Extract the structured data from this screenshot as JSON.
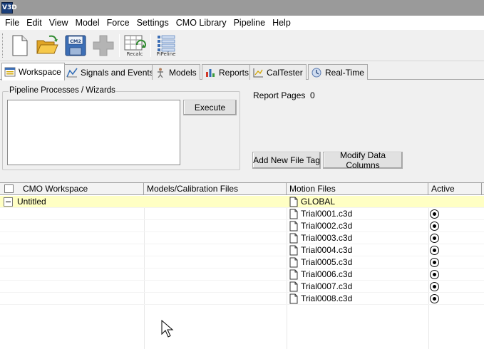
{
  "window": {
    "icon_text": "V3D"
  },
  "menu": [
    "File",
    "Edit",
    "View",
    "Model",
    "Force",
    "Settings",
    "CMO Library",
    "Pipeline",
    "Help"
  ],
  "toolbar": {
    "new_icon": "new-document-icon",
    "open_icon": "open-folder-icon",
    "save_icon": "save-disk-icon",
    "save_badge": "CM2",
    "add_icon": "plus-icon",
    "recalc_label": "Recalc",
    "pipeline_label": "PiPeline"
  },
  "tabs": [
    {
      "label": "Workspace",
      "icon": "workspace-icon",
      "active": true
    },
    {
      "label": "Signals and Events",
      "icon": "signals-icon"
    },
    {
      "label": "Models",
      "icon": "model-figure-icon"
    },
    {
      "label": "Reports",
      "icon": "bar-chart-icon"
    },
    {
      "label": "CalTester",
      "icon": "caltester-icon"
    },
    {
      "label": "Real-Time",
      "icon": "realtime-icon"
    }
  ],
  "pipeline_panel": {
    "title": "Pipeline Processes / Wizards",
    "execute_label": "Execute"
  },
  "report": {
    "label": "Report Pages",
    "count": "0"
  },
  "buttons": {
    "add_file_tag": "Add New File Tag",
    "modify_columns": "Modify Data Columns"
  },
  "grid": {
    "columns": [
      "CMO Workspace",
      "Models/Calibration Files",
      "Motion Files",
      "Active"
    ],
    "workspace_name": "Untitled",
    "global_label": "GLOBAL",
    "files": [
      "Trial0001.c3d",
      "Trial0002.c3d",
      "Trial0003.c3d",
      "Trial0004.c3d",
      "Trial0005.c3d",
      "Trial0006.c3d",
      "Trial0007.c3d",
      "Trial0008.c3d"
    ]
  },
  "colors": {
    "global_row": "#ffffc4",
    "titlebar": "#9a9a9a"
  }
}
